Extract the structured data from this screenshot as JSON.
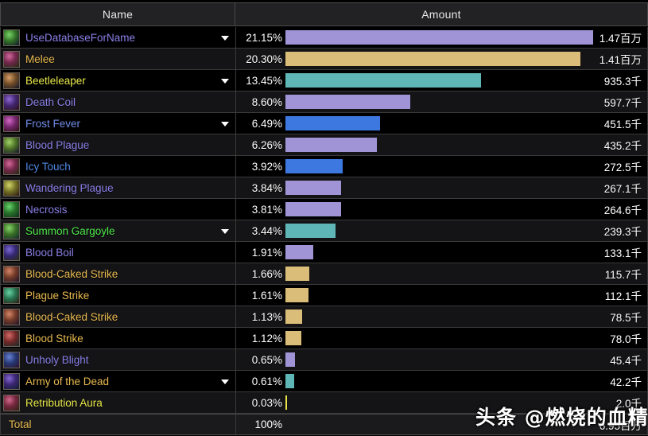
{
  "header": {
    "name_label": "Name",
    "amount_label": "Amount"
  },
  "watermark": "头条 @燃烧的血精灵",
  "total": {
    "label": "Total",
    "percent": "100%",
    "amount": "6.95百万"
  },
  "colors": {
    "bar_purple": "#a194d6",
    "bar_tan": "#d9bd78",
    "bar_teal": "#5fb6b6",
    "bar_blue": "#3d77e0",
    "bar_yellow": "#e8e04a",
    "label_purple": "#8a7fe8",
    "label_tan": "#e8b94f",
    "label_yellow": "#e8e84a",
    "label_green": "#4ee84a",
    "label_blue": "#4f8ae8",
    "header_text": "#e8e8e8"
  },
  "chart_data": {
    "type": "bar",
    "title": "",
    "xlabel": "Amount",
    "ylabel": "Name",
    "grid": false,
    "legend": "none",
    "categories": [
      "UseDatabaseForName",
      "Melee",
      "Beetleleaper",
      "Death Coil",
      "Frost Fever",
      "Blood Plague",
      "Icy Touch",
      "Wandering Plague",
      "Necrosis",
      "Summon Gargoyle",
      "Blood Boil",
      "Blood-Caked Strike",
      "Plague Strike",
      "Blood-Caked Strike",
      "Blood Strike",
      "Unholy Blight",
      "Army of the Dead",
      "Retribution Aura"
    ],
    "values": [
      21.15,
      20.3,
      13.45,
      8.6,
      6.49,
      6.26,
      3.92,
      3.84,
      3.81,
      3.44,
      1.91,
      1.66,
      1.61,
      1.13,
      1.12,
      0.65,
      0.61,
      0.03
    ],
    "ylim": [
      0,
      21.15
    ],
    "unit": "percent"
  },
  "rows": [
    {
      "name": "UseDatabaseForName",
      "percent": "21.15%",
      "amount": "1.47百万",
      "pct_value": 21.15,
      "name_color": "#8a7fe8",
      "bar_color": "#a194d6",
      "caret": true,
      "icon": "rose-icon"
    },
    {
      "name": "Melee",
      "percent": "20.30%",
      "amount": "1.41百万",
      "pct_value": 20.3,
      "name_color": "#e8b94f",
      "bar_color": "#d9bd78",
      "caret": false,
      "icon": "melee-icon"
    },
    {
      "name": "Beetleleaper",
      "percent": "13.45%",
      "amount": "935.3千",
      "pct_value": 13.45,
      "name_color": "#e8e84a",
      "bar_color": "#5fb6b6",
      "caret": true,
      "icon": "beetleleaper-icon"
    },
    {
      "name": "Death Coil",
      "percent": "8.60%",
      "amount": "597.7千",
      "pct_value": 8.6,
      "name_color": "#8a7fe8",
      "bar_color": "#a194d6",
      "caret": false,
      "icon": "death-coil-icon"
    },
    {
      "name": "Frost Fever",
      "percent": "6.49%",
      "amount": "451.5千",
      "pct_value": 6.49,
      "name_color": "#6f8ce8",
      "bar_color": "#3d77e0",
      "caret": true,
      "icon": "frost-fever-icon"
    },
    {
      "name": "Blood Plague",
      "percent": "6.26%",
      "amount": "435.2千",
      "pct_value": 6.26,
      "name_color": "#8a7fe8",
      "bar_color": "#a194d6",
      "caret": false,
      "icon": "blood-plague-icon"
    },
    {
      "name": "Icy Touch",
      "percent": "3.92%",
      "amount": "272.5千",
      "pct_value": 3.92,
      "name_color": "#4f8ae8",
      "bar_color": "#3d77e0",
      "caret": false,
      "icon": "icy-touch-icon"
    },
    {
      "name": "Wandering Plague",
      "percent": "3.84%",
      "amount": "267.1千",
      "pct_value": 3.84,
      "name_color": "#8a7fe8",
      "bar_color": "#a194d6",
      "caret": false,
      "icon": "wandering-plague-icon"
    },
    {
      "name": "Necrosis",
      "percent": "3.81%",
      "amount": "264.6千",
      "pct_value": 3.81,
      "name_color": "#8a7fe8",
      "bar_color": "#a194d6",
      "caret": false,
      "icon": "necrosis-icon"
    },
    {
      "name": "Summon Gargoyle",
      "percent": "3.44%",
      "amount": "239.3千",
      "pct_value": 3.44,
      "name_color": "#4ee84a",
      "bar_color": "#5fb6b6",
      "caret": true,
      "icon": "summon-gargoyle-icon"
    },
    {
      "name": "Blood Boil",
      "percent": "1.91%",
      "amount": "133.1千",
      "pct_value": 1.91,
      "name_color": "#8a7fe8",
      "bar_color": "#a194d6",
      "caret": false,
      "icon": "blood-boil-icon"
    },
    {
      "name": "Blood-Caked Strike",
      "percent": "1.66%",
      "amount": "115.7千",
      "pct_value": 1.66,
      "name_color": "#e8b94f",
      "bar_color": "#d9bd78",
      "caret": false,
      "icon": "blood-caked-strike-icon"
    },
    {
      "name": "Plague Strike",
      "percent": "1.61%",
      "amount": "112.1千",
      "pct_value": 1.61,
      "name_color": "#e8b94f",
      "bar_color": "#d9bd78",
      "caret": false,
      "icon": "plague-strike-icon"
    },
    {
      "name": "Blood-Caked Strike",
      "percent": "1.13%",
      "amount": "78.5千",
      "pct_value": 1.13,
      "name_color": "#e8b94f",
      "bar_color": "#d9bd78",
      "caret": false,
      "icon": "blood-caked-strike-icon"
    },
    {
      "name": "Blood Strike",
      "percent": "1.12%",
      "amount": "78.0千",
      "pct_value": 1.12,
      "name_color": "#e8b94f",
      "bar_color": "#d9bd78",
      "caret": false,
      "icon": "blood-strike-icon"
    },
    {
      "name": "Unholy Blight",
      "percent": "0.65%",
      "amount": "45.4千",
      "pct_value": 0.65,
      "name_color": "#8a7fe8",
      "bar_color": "#a194d6",
      "caret": false,
      "icon": "unholy-blight-icon"
    },
    {
      "name": "Army of the Dead",
      "percent": "0.61%",
      "amount": "42.2千",
      "pct_value": 0.61,
      "name_color": "#e8b94f",
      "bar_color": "#5fb6b6",
      "caret": true,
      "icon": "army-of-the-dead-icon"
    },
    {
      "name": "Retribution Aura",
      "percent": "0.03%",
      "amount": "2.0千",
      "pct_value": 0.03,
      "name_color": "#e8e84a",
      "bar_color": "#e8e04a",
      "caret": false,
      "icon": "retribution-aura-icon"
    }
  ]
}
